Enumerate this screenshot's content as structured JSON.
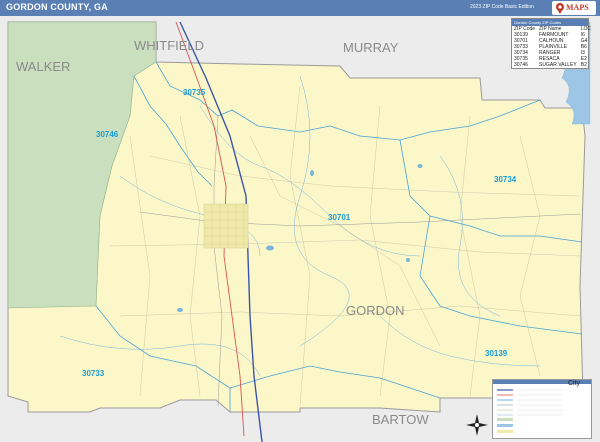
{
  "header": {
    "title": "GORDON COUNTY, GA",
    "edition": "2023 ZIP Code Basic Edition",
    "logo_text": "MAPS",
    "brand_color": "#5a7fb5"
  },
  "neighbor_labels": {
    "whitfield": "WHITFIELD",
    "murray": "MURRAY",
    "walker": "WALKER",
    "bartow": "BARTOW"
  },
  "county_label": "GORDON",
  "zip_labels": {
    "z30735": "30735",
    "z30746": "30746",
    "z30701": "30701",
    "z30734": "30734",
    "z30139": "30139",
    "z30733": "30733"
  },
  "zip_table": {
    "header": "Gordon County ZIP Codes",
    "columns": [
      "ZIP Code",
      "ZIP Name",
      "LOC"
    ],
    "rows": [
      [
        "30139",
        "FAIRMOUNT",
        "I6"
      ],
      [
        "30701",
        "CALHOUN",
        "G4"
      ],
      [
        "30733",
        "PLAINVILLE",
        "B6"
      ],
      [
        "30734",
        "RANGER",
        "I3"
      ],
      [
        "30735",
        "RESACA",
        "E2"
      ],
      [
        "30746",
        "SUGAR VALLEY",
        "B2"
      ]
    ]
  },
  "legend": {
    "city_label": "City"
  },
  "colors": {
    "county_fill": "#fbf7c9",
    "forest_fill": "#c9dfbe",
    "outside_fill": "#ececec",
    "water": "#7ab6dc",
    "zip_line": "#4aa3d8",
    "interstate": "#3d56a6",
    "us_hwy": "#d9534f",
    "zip_text": "#1a9bd7",
    "neighbor_text": "#8a8a8a"
  }
}
